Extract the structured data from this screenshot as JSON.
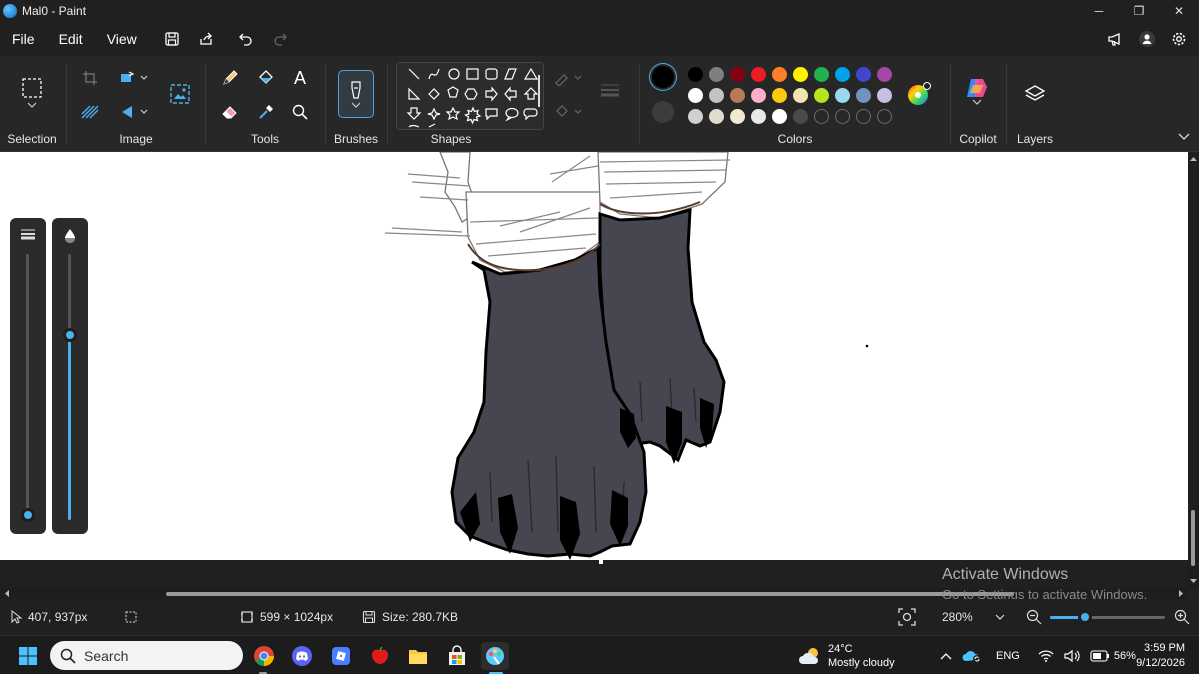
{
  "window": {
    "title": "Mal0 - Paint",
    "controls": [
      "─",
      "❐",
      "✕"
    ]
  },
  "menu": {
    "items": [
      "File",
      "Edit",
      "View"
    ]
  },
  "ribbon": {
    "groups": {
      "selection": "Selection",
      "image": "Image",
      "tools": "Tools",
      "brushes": "Brushes",
      "shapes": "Shapes",
      "colors": "Colors",
      "copilot": "Copilot",
      "layers": "Layers"
    },
    "tools_text_glyph": "A",
    "primary_color": "#000000",
    "secondary_color": "#3c3c3c",
    "palette_row1": [
      "#000000",
      "#7f7f7f",
      "#880015",
      "#ed1c24",
      "#ff7f27",
      "#fff200",
      "#22b14c",
      "#00a2e8",
      "#3f48cc",
      "#a349a4"
    ],
    "palette_row2": [
      "#ffffff",
      "#c3c3c3",
      "#b97a57",
      "#ffaec9",
      "#ffc90e",
      "#efe4b0",
      "#b5e61d",
      "#99d9ea",
      "#7092be",
      "#c8bfe7"
    ],
    "palette_row3": [
      "#d0d0d0",
      "#e0dcd0",
      "#f2ead0",
      "#e8e8e8",
      "#ffffff",
      "#4a4a4a"
    ]
  },
  "canvas": {
    "background": "#ffffff",
    "paw_color": "#464650",
    "outline_color": "#000000"
  },
  "watermark": {
    "title": "Activate Windows",
    "subtitle": "Go to Settings to activate Windows."
  },
  "status": {
    "cursor_position": "407, 937px",
    "canvas_size": "599 × 1024px",
    "file_size": "Size: 280.7KB",
    "zoom": "280%",
    "zoom_fraction": 0.3
  },
  "taskbar": {
    "search_placeholder": "Search",
    "weather_temp": "24°C",
    "weather_desc": "Mostly cloudy",
    "language": "ENG",
    "battery": "56%",
    "time": "3:59 PM",
    "date": "9/12/2026"
  }
}
